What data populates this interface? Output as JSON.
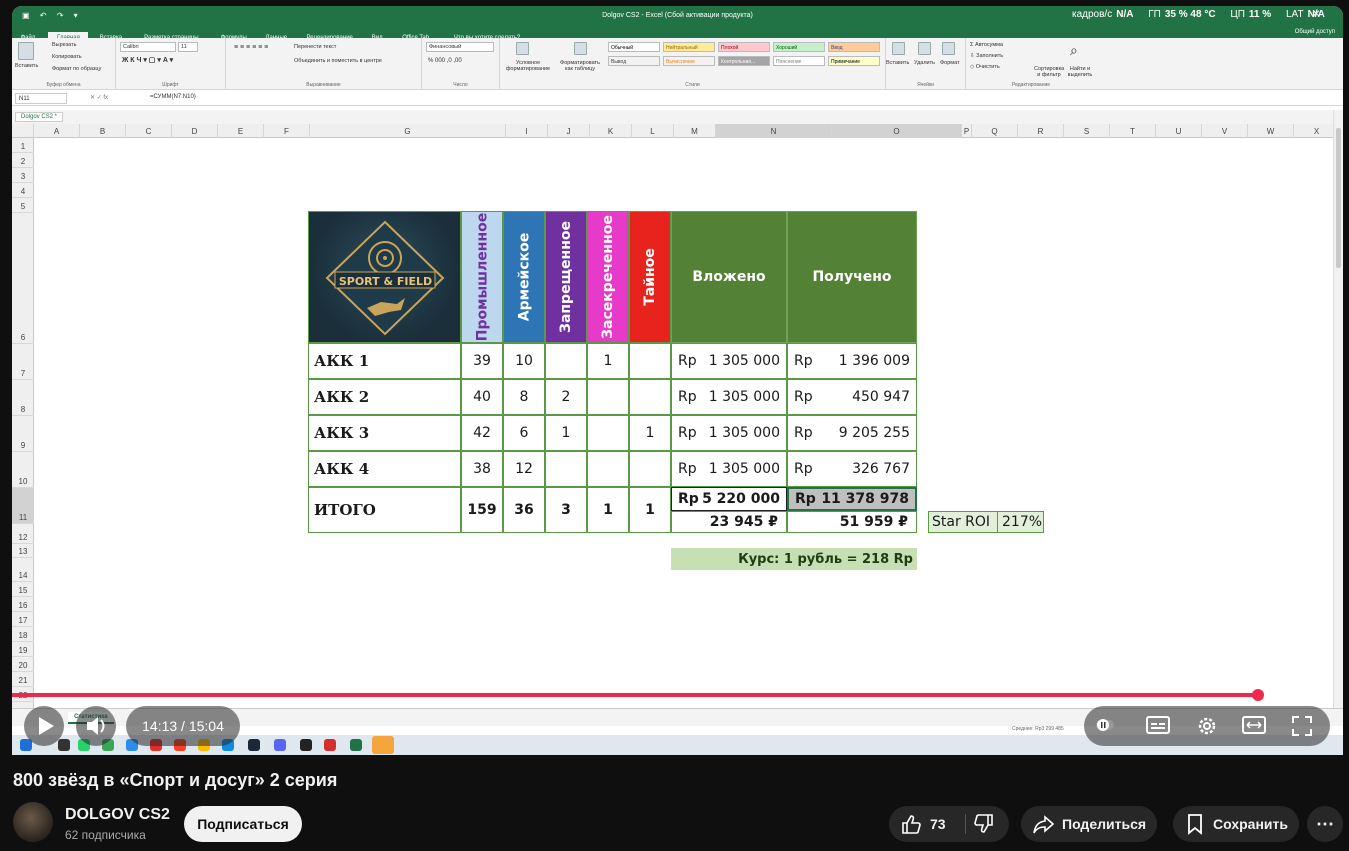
{
  "excel": {
    "window_title": "Dolgov CS2 - Excel (Сбой активации продукта)",
    "hud": {
      "label1": "кадров/с",
      "val1": "N/A",
      "label2": "ГП",
      "val2": "35 % 48 °C",
      "label3": "ЦП",
      "val3": "11 %",
      "label4": "LAT",
      "val4": "N/A"
    },
    "tabs": [
      "Файл",
      "Главная",
      "Вставка",
      "Разметка страницы",
      "Формулы",
      "Данные",
      "Рецензирование",
      "Вид",
      "Office Tab",
      "Что вы хотите сделать?"
    ],
    "share": "Общий доступ",
    "ribbon": {
      "clipboard": {
        "paste": "Вставить",
        "cut": "Вырезать",
        "copy": "Копировать",
        "painter": "Формат по образцу",
        "label": "Буфер обмена"
      },
      "font": {
        "name": "Calibri",
        "size": "11",
        "label": "Шрифт"
      },
      "align": {
        "wrap": "Перенести текст",
        "merge": "Объединить и поместить в центре",
        "label": "Выравнивание"
      },
      "number": {
        "format": "Финансовый",
        "label": "Число"
      },
      "styles": {
        "cond": "Условное форматирование",
        "table": "Форматировать как таблицу",
        "label": "Стили",
        "cells": [
          {
            "t": "Обычный",
            "bg": "#ffffff",
            "fg": "#000"
          },
          {
            "t": "Нейтральный",
            "bg": "#ffeb9c",
            "fg": "#9c6500"
          },
          {
            "t": "Плохой",
            "bg": "#ffc7ce",
            "fg": "#9c0006"
          },
          {
            "t": "Хороший",
            "bg": "#c6efce",
            "fg": "#006100"
          },
          {
            "t": "Ввод",
            "bg": "#ffcc99",
            "fg": "#3f3f76"
          },
          {
            "t": "Вывод",
            "bg": "#f2f2f2",
            "fg": "#3f3f3f"
          },
          {
            "t": "Вычисление",
            "bg": "#f2f2f2",
            "fg": "#fa7d00"
          },
          {
            "t": "Контрольная...",
            "bg": "#a5a5a5",
            "fg": "#ffffff"
          },
          {
            "t": "Пояснение",
            "bg": "#ffffff",
            "fg": "#7f7f7f"
          },
          {
            "t": "Примечание",
            "bg": "#ffffcc",
            "fg": "#000"
          }
        ]
      },
      "cells": {
        "insert": "Вставить",
        "delete": "Удалить",
        "format": "Формат",
        "label": "Ячейки"
      },
      "edit": {
        "autosum": "Автосумма",
        "fill": "Заполнить",
        "clear": "Очистить",
        "sort": "Сортировка и фильтр",
        "find": "Найти и выделить",
        "label": "Редактирование"
      }
    },
    "name_box": "N11",
    "formula": "=СУММ(N7:N10)",
    "workbook_tab": "Dolgov CS2 *",
    "columns": [
      "A",
      "B",
      "C",
      "D",
      "E",
      "F",
      "G",
      "I",
      "J",
      "K",
      "L",
      "M",
      "N",
      "O",
      "P",
      "Q",
      "R",
      "S",
      "T",
      "U",
      "V",
      "W",
      "X"
    ],
    "rows": [
      "1",
      "2",
      "3",
      "4",
      "5",
      "6",
      "7",
      "8",
      "9",
      "10",
      "11",
      "12",
      "13",
      "14",
      "15",
      "16",
      "17",
      "18",
      "19",
      "20",
      "21",
      "22"
    ],
    "table": {
      "headers": [
        {
          "t": "Промышленное",
          "bg": "#bdd7ee",
          "fg": "#7030a0"
        },
        {
          "t": "Армейское",
          "bg": "#2e75b6",
          "fg": "#ffffff"
        },
        {
          "t": "Запрещенное",
          "bg": "#7030a0",
          "fg": "#ffffff"
        },
        {
          "t": "Засекреченное",
          "bg": "#e83ac8",
          "fg": "#ffffff"
        },
        {
          "t": "Тайное",
          "bg": "#e8231d",
          "fg": "#ffffff"
        }
      ],
      "invested": "Вложено",
      "received": "Получено",
      "rows": [
        {
          "name": "АКК 1",
          "c": [
            "39",
            "10",
            "",
            "1",
            ""
          ],
          "cur": "Rp",
          "inv": "1 305 000",
          "rec": "1 396 009"
        },
        {
          "name": "АКК 2",
          "c": [
            "40",
            "8",
            "2",
            "",
            ""
          ],
          "cur": "Rp",
          "inv": "1 305 000",
          "rec": "450 947"
        },
        {
          "name": "АКК 3",
          "c": [
            "42",
            "6",
            "1",
            "",
            "1"
          ],
          "cur": "Rp",
          "inv": "1 305 000",
          "rec": "9 205 255"
        },
        {
          "name": "АКК 4",
          "c": [
            "38",
            "12",
            "",
            "",
            ""
          ],
          "cur": "Rp",
          "inv": "1 305 000",
          "rec": "326 767"
        }
      ],
      "total": {
        "name": "ИТОГО",
        "c": [
          "159",
          "36",
          "3",
          "1",
          "1"
        ],
        "cur": "Rp",
        "inv": "5 220 000",
        "rec": "11 378 978",
        "inv_rub": "23 945 ₽",
        "rec_rub": "51 959 ₽"
      },
      "roi_label": "Star ROI",
      "roi_value": "217%",
      "rate": "Курс: 1 рубль = 218 Rp",
      "logo_text": "SPORT & FIELD"
    },
    "sheet_tab": "Статистика",
    "status_avg": "Среднее: Rp3 299 485"
  },
  "video": {
    "time": "14:13 / 15:04",
    "progress": 0.945,
    "title": "800 звёзд в «Спорт и досуг» 2 серия",
    "channel": "DOLGOV CS2",
    "subscribers": "62 подписчика",
    "subscribe": "Подписаться",
    "likes": "73",
    "share": "Поделиться",
    "save": "Сохранить"
  }
}
